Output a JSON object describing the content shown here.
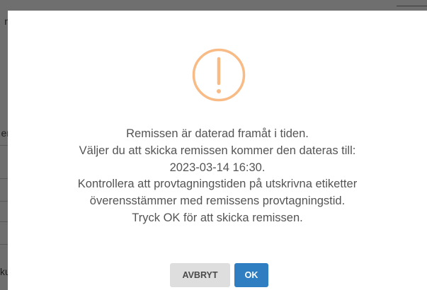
{
  "background": {
    "glyphs": [
      "n",
      "er",
      "ku"
    ]
  },
  "dialog": {
    "icon": "exclamation-circle-icon",
    "icon_color": "#f8bb86",
    "message_lines": [
      "Remissen är daterad framåt i tiden.",
      "Väljer du att skicka remissen kommer den dateras till:",
      "2023-03-14 16:30.",
      "Kontrollera att provtagningstiden på utskrivna etiketter",
      "överensstämmer med remissens provtagningstid.",
      "Tryck OK för att skicka remissen."
    ],
    "buttons": {
      "cancel_label": "AVBRYT",
      "ok_label": "OK"
    },
    "colors": {
      "ok_button": "#2f7ec1",
      "cancel_button": "#dedede",
      "text": "#545454"
    }
  }
}
